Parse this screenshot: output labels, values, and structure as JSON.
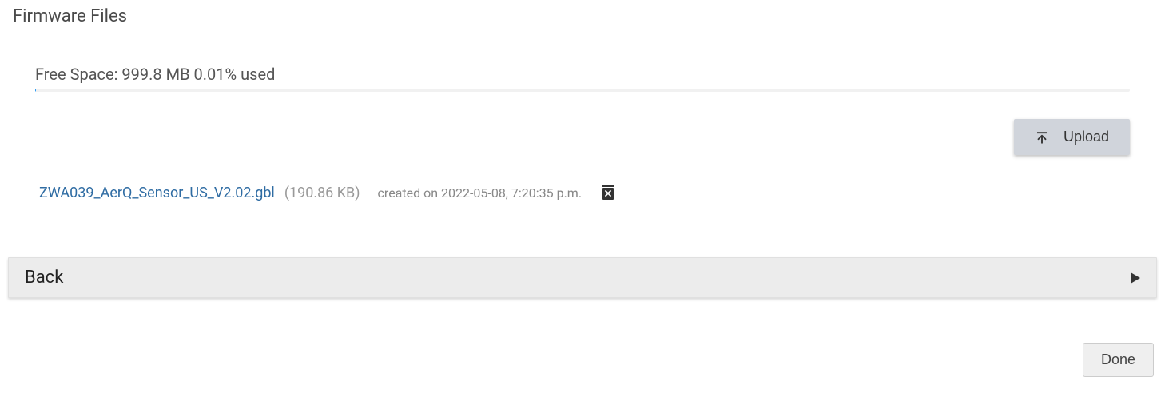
{
  "header": {
    "title": "Firmware Files"
  },
  "storage": {
    "label": "Free Space: 999.8 MB 0.01% used",
    "percent_used": 0.01
  },
  "actions": {
    "upload_label": "Upload",
    "back_label": "Back",
    "done_label": "Done"
  },
  "files": [
    {
      "name": "ZWA039_AerQ_Sensor_US_V2.02.gbl",
      "size_display": "(190.86 KB)",
      "created_display": "created on 2022-05-08, 7:20:35 p.m."
    }
  ]
}
